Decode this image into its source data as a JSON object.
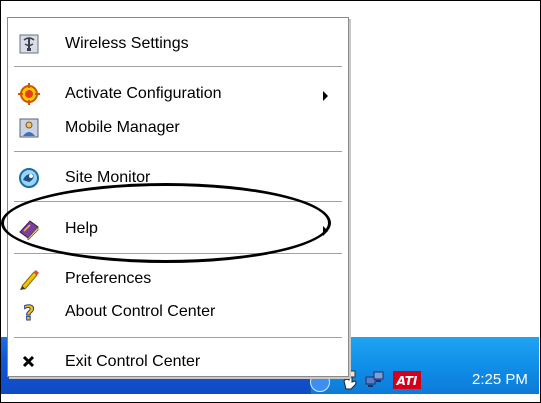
{
  "menu": {
    "items": [
      {
        "label": "Wireless Settings",
        "icon": "wireless-settings-icon",
        "submenu": false
      },
      {
        "label": "Activate Configuration",
        "icon": "activate-configuration-icon",
        "submenu": true
      },
      {
        "label": "Mobile Manager",
        "icon": "mobile-manager-icon",
        "submenu": false
      },
      {
        "label": "Site Monitor",
        "icon": "site-monitor-icon",
        "submenu": false
      },
      {
        "label": "Help",
        "icon": "help-book-icon",
        "submenu": true
      },
      {
        "label": "Preferences",
        "icon": "pencil-icon",
        "submenu": false
      },
      {
        "label": "About Control Center",
        "icon": "question-mark-icon",
        "submenu": false
      },
      {
        "label": "Exit Control Center",
        "icon": "close-x-icon",
        "submenu": false
      }
    ]
  },
  "taskbar": {
    "clock": "2:25 PM",
    "tray_icons": [
      "network-hand-icon",
      "network-connection-icon",
      "ati-icon"
    ],
    "tray_logo_text": "ATI"
  },
  "colors": {
    "taskbar_blue": "#1155d6",
    "tray_blue": "#108fe8",
    "highlight_ellipse": "#000000"
  }
}
